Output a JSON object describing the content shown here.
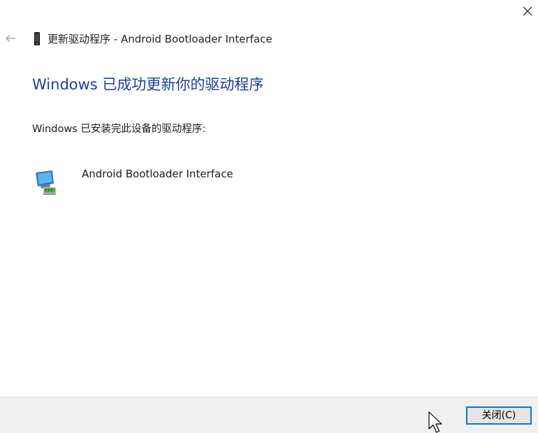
{
  "window": {
    "title": "更新驱动程序 - Android Bootloader Interface"
  },
  "main": {
    "heading": "Windows 已成功更新你的驱动程序",
    "subtext": "Windows 已安装完此设备的驱动程序:",
    "device_name": "Android Bootloader Interface"
  },
  "footer": {
    "close_button_label": "关闭(C)"
  },
  "colors": {
    "heading": "#1b3f9f",
    "button_border": "#0078d7",
    "footer_bg": "#f0f0f0"
  },
  "icons": {
    "window_close": "close-icon",
    "back": "back-arrow-icon",
    "title": "phone-device-icon",
    "device": "network-device-icon",
    "pointer": "mouse-cursor-icon"
  }
}
